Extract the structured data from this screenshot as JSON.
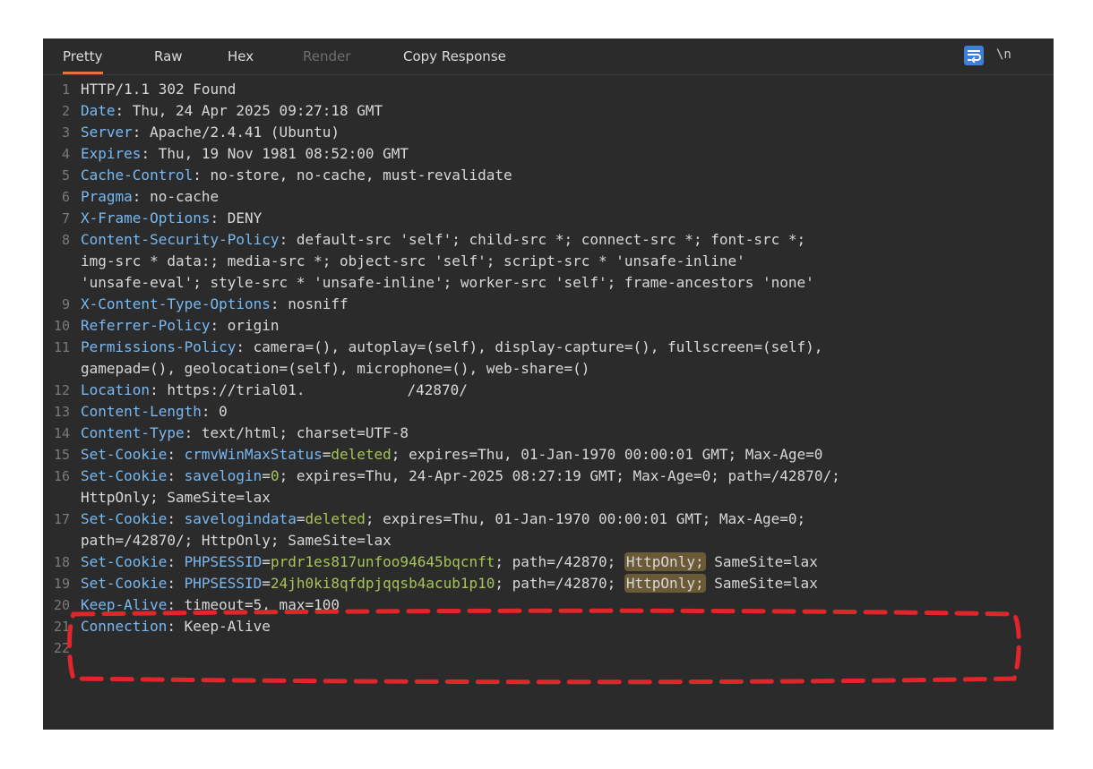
{
  "tabs": [
    {
      "label": "Pretty",
      "active": true
    },
    {
      "label": "Raw"
    },
    {
      "label": "Hex"
    },
    {
      "label": "Render",
      "disabled": true
    },
    {
      "label": "Copy Response"
    }
  ],
  "toolbar": {
    "wrap_icon": "wrap-lines-icon",
    "newline_label": "\\n"
  },
  "lines": [
    {
      "n": "1",
      "key": "HTTP/1.1 302 Found",
      "sep": "",
      "val": ""
    },
    {
      "n": "2",
      "key": "Date",
      "sep": ": ",
      "val": "Thu, 24 Apr 2025 09:27:18 GMT"
    },
    {
      "n": "3",
      "key": "Server",
      "sep": ": ",
      "val": "Apache/2.4.41 (Ubuntu)"
    },
    {
      "n": "4",
      "key": "Expires",
      "sep": ": ",
      "val": "Thu, 19 Nov 1981 08:52:00 GMT"
    },
    {
      "n": "5",
      "key": "Cache-Control",
      "sep": ": ",
      "val": "no-store, no-cache, must-revalidate"
    },
    {
      "n": "6",
      "key": "Pragma",
      "sep": ": ",
      "val": "no-cache"
    },
    {
      "n": "7",
      "key": "X-Frame-Options",
      "sep": ": ",
      "val": "DENY"
    },
    {
      "n": "8",
      "key": "Content-Security-Policy",
      "sep": ": ",
      "val": "default-src 'self'; child-src *; connect-src *; font-src *;"
    },
    {
      "n": "",
      "key": "",
      "sep": "",
      "val": "img-src * data:; media-src *; object-src 'self'; script-src * 'unsafe-inline'"
    },
    {
      "n": "",
      "key": "",
      "sep": "",
      "val": "'unsafe-eval'; style-src * 'unsafe-inline'; worker-src 'self'; frame-ancestors 'none'"
    },
    {
      "n": "9",
      "key": "X-Content-Type-Options",
      "sep": ": ",
      "val": "nosniff"
    },
    {
      "n": "10",
      "key": "Referrer-Policy",
      "sep": ": ",
      "val": "origin"
    },
    {
      "n": "11",
      "key": "Permissions-Policy",
      "sep": ": ",
      "val": "camera=(), autoplay=(self), display-capture=(), fullscreen=(self),"
    },
    {
      "n": "",
      "key": "",
      "sep": "",
      "val": "gamepad=(), geolocation=(self), microphone=(), web-share=()"
    },
    {
      "n": "12",
      "key": "Location",
      "sep": ": ",
      "val": "https://trial01.",
      "redacted": true,
      "val2": "/42870/"
    },
    {
      "n": "13",
      "key": "Content-Length",
      "sep": ": ",
      "val": "0"
    },
    {
      "n": "14",
      "key": "Content-Type",
      "sep": ": ",
      "val": "text/html; charset=UTF-8"
    },
    {
      "n": "15",
      "key": "Set-Cookie",
      "sep": ": ",
      "ck": "crmvWinMaxStatus",
      "cv": "deleted",
      "rest": "; expires=Thu, 01-Jan-1970 00:00:01 GMT; Max-Age=0"
    },
    {
      "n": "16",
      "key": "Set-Cookie",
      "sep": ": ",
      "ck": "savelogin",
      "cv": "0",
      "rest": "; expires=Thu, 24-Apr-2025 08:27:19 GMT; Max-Age=0; path=/42870/;"
    },
    {
      "n": "",
      "key": "",
      "sep": "",
      "val": "HttpOnly; SameSite=lax"
    },
    {
      "n": "17",
      "key": "Set-Cookie",
      "sep": ": ",
      "ck": "savelogindata",
      "cv": "deleted",
      "rest": "; expires=Thu, 01-Jan-1970 00:00:01 GMT; Max-Age=0;"
    },
    {
      "n": "",
      "key": "",
      "sep": "",
      "val": "path=/42870/; HttpOnly; SameSite=lax"
    },
    {
      "n": "18",
      "key": "Set-Cookie",
      "sep": ": ",
      "ck": "PHPSESSID",
      "cv": "prdr1es817unfoo94645bqcnft",
      "rest": "; path=/42870; ",
      "hl": "HttpOnly;",
      "tail": " SameSite=lax"
    },
    {
      "n": "19",
      "key": "Set-Cookie",
      "sep": ": ",
      "ck": "PHPSESSID",
      "cv": "24jh0ki8qfdpjqqsb4acub1p10",
      "rest": "; path=/42870; ",
      "hl": "HttpOnly;",
      "tail": " SameSite=lax"
    },
    {
      "n": "20",
      "key": "Keep-Alive",
      "sep": ": ",
      "val": "timeout=5, max=100"
    },
    {
      "n": "21",
      "key": "Connection",
      "sep": ": ",
      "val": "Keep-Alive"
    },
    {
      "n": "22",
      "key": "",
      "sep": "",
      "val": ""
    }
  ],
  "colors": {
    "background": "#2b2b2b",
    "header_key": "#79b8f0",
    "cookie_value": "#a6c45a",
    "highlight": "#6a5a35",
    "active_tab_underline": "#e8743b",
    "annotation": "#e0262b"
  }
}
